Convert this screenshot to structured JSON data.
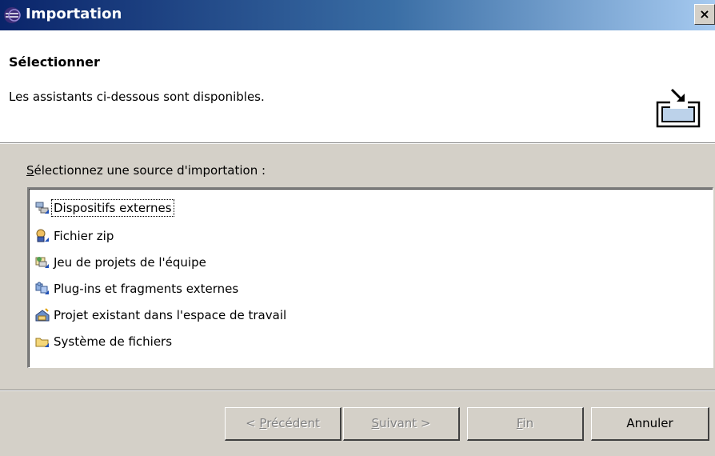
{
  "window": {
    "title": "Importation",
    "close_glyph": "×"
  },
  "header": {
    "title": "Sélectionner",
    "description": "Les assistants ci-dessous sont disponibles."
  },
  "list": {
    "label_mnemonic": "S",
    "label_rest": "électionnez une source d'importation :",
    "items": [
      {
        "label": "Dispositifs externes",
        "icon": "external-devices-icon"
      },
      {
        "label": "Fichier zip",
        "icon": "zip-file-icon"
      },
      {
        "label": "Jeu de projets de l'équipe",
        "icon": "team-project-set-icon"
      },
      {
        "label": "Plug-ins et fragments externes",
        "icon": "plugins-icon"
      },
      {
        "label": "Projet existant dans l'espace de travail",
        "icon": "existing-project-icon"
      },
      {
        "label": "Système de fichiers",
        "icon": "folder-icon"
      }
    ],
    "selected_index": 0
  },
  "buttons": {
    "previous": {
      "pre": "< ",
      "mnemonic": "P",
      "rest": "récédent"
    },
    "next": {
      "pre": "",
      "mnemonic": "S",
      "rest": "uivant >"
    },
    "finish": {
      "pre": "",
      "mnemonic": "F",
      "rest": "in"
    },
    "cancel": {
      "label": "Annuler"
    }
  }
}
